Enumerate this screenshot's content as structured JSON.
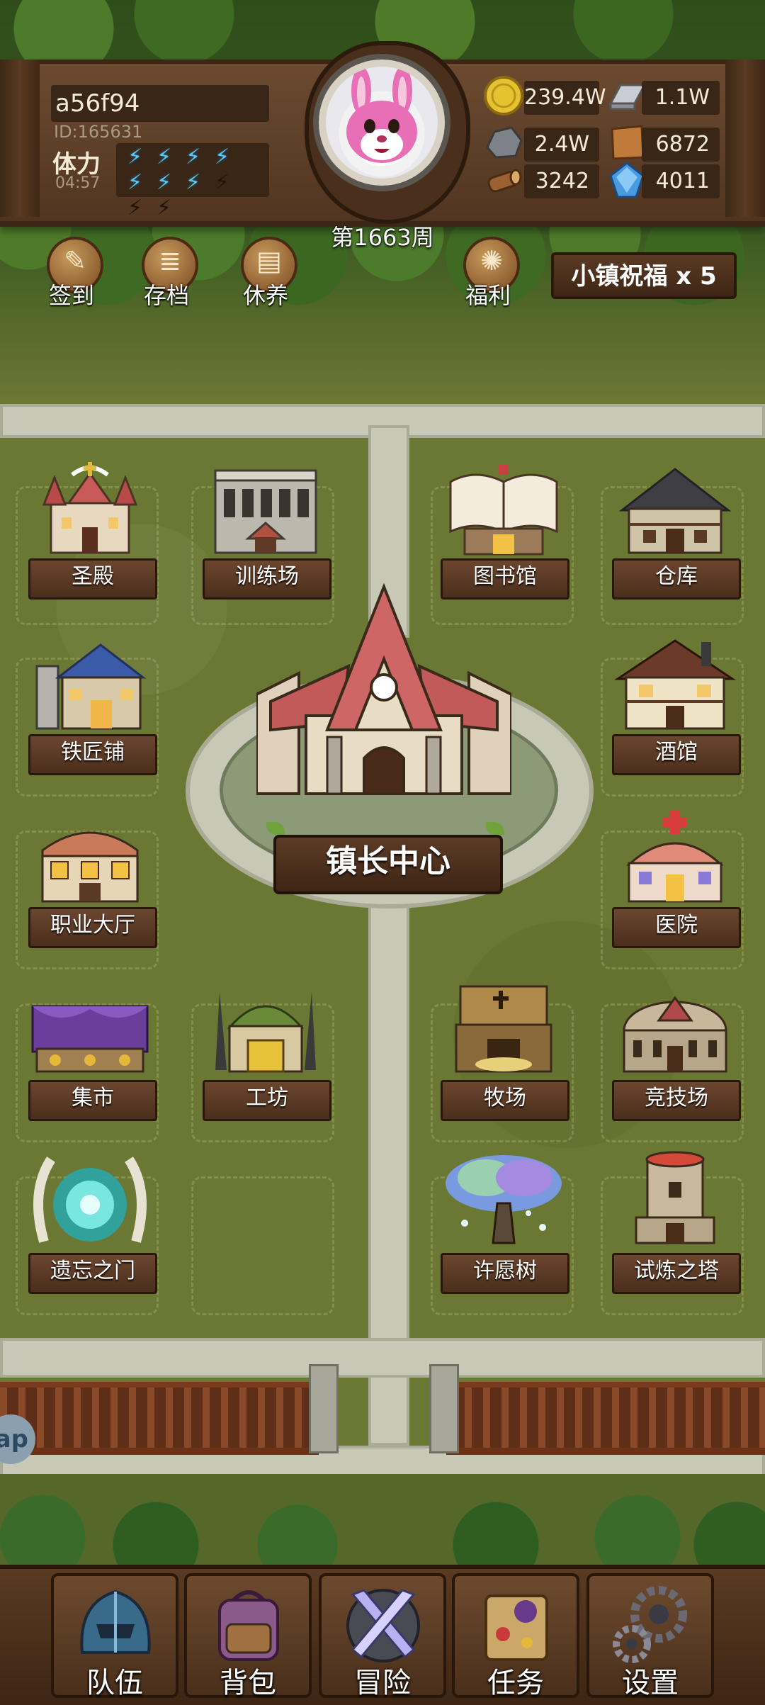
{
  "player": {
    "name": "a56f94",
    "id": "ID:165631",
    "stamina_label": "体力",
    "stamina_timer": "04:57",
    "stamina": {
      "current": 7,
      "max": 10
    },
    "week": "第1663周"
  },
  "resources": {
    "gold": "239.4W",
    "iron": "1.1W",
    "stone": "2.4W",
    "leather": "6872",
    "wood": "3242",
    "crystal": "4011"
  },
  "shortcuts": [
    {
      "label": "签到",
      "icon": "quill-scroll-icon"
    },
    {
      "label": "存档",
      "icon": "scroll-icon"
    },
    {
      "label": "休养",
      "icon": "sign-board-icon"
    },
    {
      "label": "福利",
      "icon": "wheel-icon"
    }
  ],
  "blessing": {
    "label": "小镇祝福 x 5"
  },
  "town_hall": {
    "label": "镇长中心"
  },
  "buildings": {
    "temple": "圣殿",
    "training_ground": "训练场",
    "library": "图书馆",
    "warehouse": "仓库",
    "blacksmith": "铁匠铺",
    "tavern": "酒馆",
    "job_hall": "职业大厅",
    "hospital": "医院",
    "market": "集市",
    "workshop": "工坊",
    "ranch": "牧场",
    "arena": "竞技场",
    "forgotten_gate": "遗忘之门",
    "wishing_tree": "许愿树",
    "trial_tower": "试炼之塔"
  },
  "side_tab": {
    "label": "ap"
  },
  "nav": [
    {
      "label": "队伍",
      "icon": "helmet-icon"
    },
    {
      "label": "背包",
      "icon": "backpack-icon"
    },
    {
      "label": "冒险",
      "icon": "crossed-swords-icon"
    },
    {
      "label": "任务",
      "icon": "quest-scroll-icon"
    },
    {
      "label": "设置",
      "icon": "gears-icon"
    }
  ],
  "colors": {
    "hud_brown": "#523521",
    "field_green": "#6a7833",
    "road_grey": "#c7c9b6",
    "stamina_blue": "#5ac8f0",
    "plaque_brown": "#4b2e1c"
  }
}
